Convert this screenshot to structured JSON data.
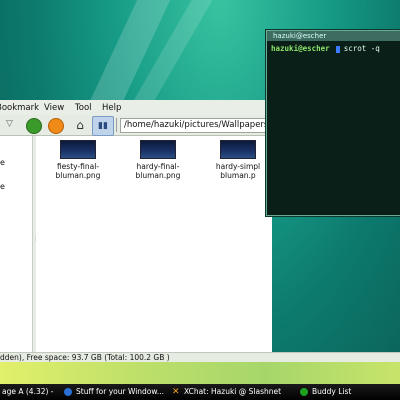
{
  "file_manager": {
    "menu": [
      "Bookmark",
      "View",
      "Tool",
      "Help"
    ],
    "path": "/home/hazuki/pictures/Wallpapers",
    "sidebar_labels": [
      "e",
      "e"
    ],
    "files": [
      {
        "name": "fiesty-final-\nbluman.png"
      },
      {
        "name": "hardy-final-\nbluman.png"
      },
      {
        "name": "hardy-simpl\nbluman.p"
      }
    ],
    "status": "dden), Free space: 93.7 GB (Total: 100.2 GB )"
  },
  "terminal": {
    "title": "hazuki@escher",
    "user": "hazuki@escher",
    "command": "scrot -q"
  },
  "taskbar": {
    "items": [
      {
        "label": "age A (4.32) -"
      },
      {
        "label": "Stuff for your Window..."
      },
      {
        "label": "XChat: Hazuki @ Slashnet"
      },
      {
        "label": "Buddy List"
      }
    ]
  }
}
